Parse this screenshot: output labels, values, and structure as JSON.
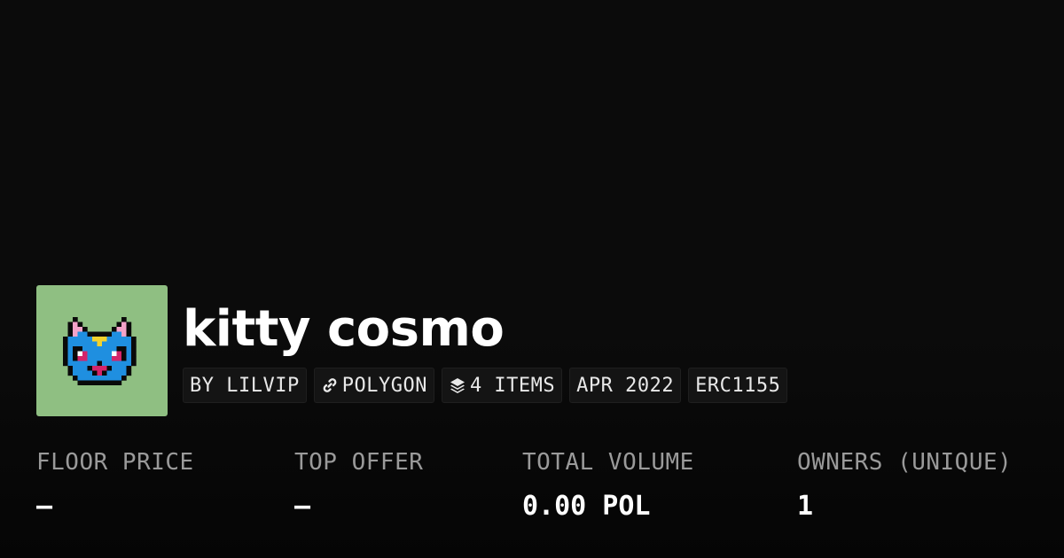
{
  "collection": {
    "name": "kitty cosmo",
    "thumbnail_bg": "#8fbf82",
    "thumbnail_icon": "pixel-cat-icon"
  },
  "tags": {
    "creator": "BY LILVIP",
    "chain": "POLYGON",
    "chain_icon": "polygon-link-icon",
    "items": "4 ITEMS",
    "items_icon": "layers-icon",
    "date": "APR 2022",
    "standard": "ERC1155"
  },
  "stats": [
    {
      "label": "FLOOR PRICE",
      "value": "–"
    },
    {
      "label": "TOP OFFER",
      "value": "–"
    },
    {
      "label": "TOTAL VOLUME",
      "value": "0.00 POL"
    },
    {
      "label": "OWNERS (UNIQUE)",
      "value": "1"
    }
  ],
  "colors": {
    "background": "#0b0b0b",
    "label": "#9a9a9a",
    "text": "#ffffff",
    "tag_bg": "#141414"
  }
}
